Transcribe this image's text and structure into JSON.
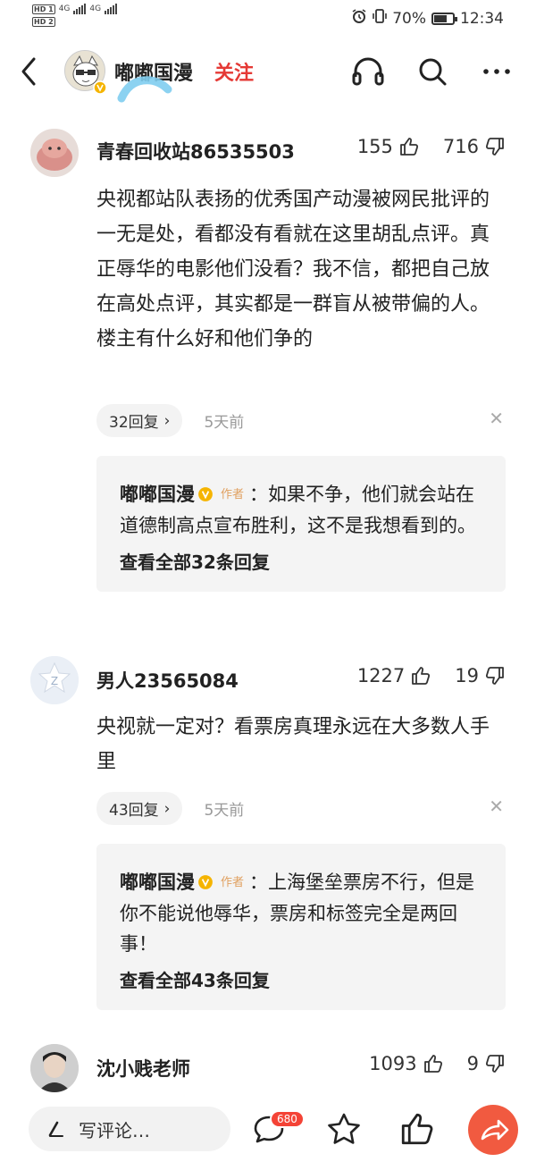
{
  "status_bar": {
    "sim1": "HD 1",
    "sim2": "HD 2",
    "net1": "4G",
    "net2": "4G",
    "battery": "70%",
    "battery_level": 0.7,
    "time": "12:34"
  },
  "header": {
    "account_name": "嘟嘟国漫",
    "follow_label": "关注"
  },
  "comments": [
    {
      "user": "青春回收站86535503",
      "likes": "155",
      "dislikes": "716",
      "text": "央视都站队表扬的优秀国产动漫被网民批评的一无是处，看都没有看就在这里胡乱点评。真正辱华的电影他们没看？我不信，都把自己放在高处点评，其实都是一群盲从被带偏的人。楼主有什么好和他们争的",
      "reply_count": "32回复",
      "time": "5天前",
      "reply": {
        "author": "嘟嘟国漫",
        "tag": "作者",
        "text": "：如果不争，他们就会站在道德制高点宣布胜利，这不是我想看到的。",
        "see_all": "查看全部32条回复"
      }
    },
    {
      "user": "男人23565084",
      "likes": "1227",
      "dislikes": "19",
      "text": "央视就一定对？看票房真理永远在大多数人手里",
      "reply_count": "43回复",
      "time": "5天前",
      "reply": {
        "author": "嘟嘟国漫",
        "tag": "作者",
        "text": "：上海堡垒票房不行，但是你不能说他辱华，票房和标签完全是两回事！",
        "see_all": "查看全部43条回复"
      }
    },
    {
      "user": "沈小贱老师",
      "likes": "1093",
      "dislikes": "9"
    }
  ],
  "bottom_bar": {
    "write_placeholder": "写评论…",
    "comment_badge": "680"
  },
  "colors": {
    "accent_red": "#e53935",
    "share_orange": "#f15a40",
    "vip_badge": "#f5b400"
  }
}
